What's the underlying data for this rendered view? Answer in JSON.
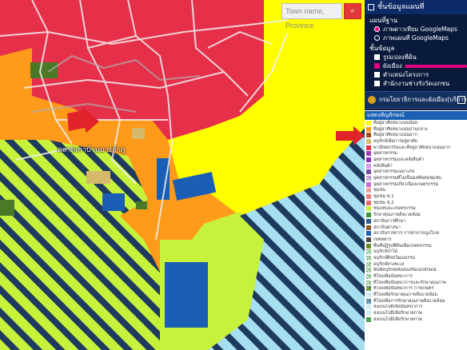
{
  "map": {
    "place_label": "ตลาดเก่าบ้านบางลำภู",
    "search_placeholder": "Town name, Province",
    "search_button_icon": "search-icon"
  },
  "panel": {
    "header_title": "ชั้นข้อมูลแผนที่",
    "basemap_title": "แผนที่ฐาน",
    "basemap_options": [
      {
        "label": "ภาพดาวเทียม GoogleMaps",
        "selected": true
      },
      {
        "label": "ภาพแผนที่ GoogleMaps",
        "selected": false
      }
    ],
    "layers_title": "ชั้นข้อมูล",
    "layers": [
      {
        "label": "รูปแปลงที่ดิน",
        "checked": false
      },
      {
        "label": "ผังเมือง",
        "checked": true
      },
      {
        "label": "ตำแหน่งโครงการ",
        "checked": false
      },
      {
        "label": "สำนักงานช่างรังวัดเอกชน",
        "checked": false
      }
    ],
    "department": "กรมโยธาธิการและผังเมือง(บริการข้อมูล)"
  },
  "legend": {
    "title": "แสดงสัญลักษณ์",
    "items": [
      {
        "label": "ที่อยู่อาศัยหนาแน่นน้อย",
        "color": "#ffff00",
        "hatch": ""
      },
      {
        "label": "ที่อยู่อาศัยหนาแน่นปานกลาง",
        "color": "#ff9a1a",
        "hatch": ""
      },
      {
        "label": "ที่อยู่อาศัยหนาแน่นมาก",
        "color": "#a34b1f",
        "hatch": ""
      },
      {
        "label": "อนุรักษ์เพื่อการอยู่อาศัย",
        "color": "#d6b96a",
        "hatch": ""
      },
      {
        "label": "พาณิชยกรรมและที่อยู่อาศัยหนาแน่นมาก",
        "color": "#e6304a",
        "hatch": ""
      },
      {
        "label": "อุตสาหกรรม",
        "color": "#a03ec4",
        "hatch": ""
      },
      {
        "label": "อุตสาหกรรมและคลังสินค้า",
        "color": "#8a2fb8",
        "hatch": ""
      },
      {
        "label": "คลังสินค้า",
        "color": "#d49be8",
        "hatch": ""
      },
      {
        "label": "อุตสาหกรรมเฉพาะกิจ",
        "color": "#7a4aa8",
        "hatch": ""
      },
      {
        "label": "อุตสาหกรรมที่ไม่เป็นมลพิษต่อชุมชน",
        "color": "#b46ad0",
        "hatch": "h3"
      },
      {
        "label": "อุตสาหกรรมเกี่ยวเนื่องเกษตรกรรม",
        "color": "#c56bd4",
        "hatch": ""
      },
      {
        "label": "ชุมชน",
        "color": "#f0a0a0",
        "hatch": ""
      },
      {
        "label": "ชุมชน ช.1",
        "color": "#f08080",
        "hatch": ""
      },
      {
        "label": "ชุมชน ช.2",
        "color": "#e86a6a",
        "hatch": ""
      },
      {
        "label": "ชนบทและเกษตรกรรม",
        "color": "#c7f23c",
        "hatch": ""
      },
      {
        "label": "รักษาคุณภาพสิ่งแวดล้อม",
        "color": "#3f8f3f",
        "hatch": ""
      },
      {
        "label": "สถาบันการศึกษา",
        "color": "#2a5f8a",
        "hatch": ""
      },
      {
        "label": "สถาบันศาสนา",
        "color": "#8a5a2a",
        "hatch": ""
      },
      {
        "label": "สถาบันราชการ การสาธารณูปโภค",
        "color": "#1a5fb4",
        "hatch": ""
      },
      {
        "label": "เขตทหาร",
        "color": "#4a4a4a",
        "hatch": ""
      },
      {
        "label": "พื้นที่ปฏิรูปที่ดินเพื่อเกษตรกรรม",
        "color": "#6a8a2a",
        "hatch": ""
      },
      {
        "label": "อนุรักษ์ป่าไม้",
        "color": "#4a9d4a",
        "hatch": "h1"
      },
      {
        "label": "อนุรักษ์ศิลปวัฒนธรรม",
        "color": "#7ac97a",
        "hatch": "h1"
      },
      {
        "label": "อนุรักษ์ทางทะเล",
        "color": "#8ecf8e",
        "hatch": "h1"
      },
      {
        "label": "พื้นที่อนุรักษ์เพื่อส่งเสริมเอกลักษณ์",
        "color": "#a6e0a6",
        "hatch": "h1"
      },
      {
        "label": "ที่โล่งเพื่อนันทนาการ",
        "color": "#b8e8b8",
        "hatch": "h1"
      },
      {
        "label": "ที่โล่งเพื่อนันทนาการและรักษาคุณภาพ",
        "color": "#cfeecf",
        "hatch": "h1"
      },
      {
        "label": "ที่โล่งเพื่อนันทนาการ การเกษตร",
        "color": "#c7f23c",
        "hatch": "h4"
      },
      {
        "label": "ที่โล่งเพื่อรักษาคุณภาพสิ่งแวดล้อม",
        "color": "#a6dff0",
        "hatch": "h2"
      },
      {
        "label": "ที่โล่งเพื่อการรักษาคุณภาพสิ่งแวดล้อม",
        "color": "#8fd0e8",
        "hatch": "h5"
      },
      {
        "label": "ลงเบนโปมีเพื่อนันทนาการ",
        "color": "#b0e0f0",
        "hatch": "h2"
      },
      {
        "label": "ลงเบนโปมีเพื่อรักษาสภาพ",
        "color": "#c0e8f5",
        "hatch": "h2"
      },
      {
        "label": "ลงเบนโปมีเพื่อรักษาสภาพ",
        "color": "#4a9d4a",
        "hatch": ""
      }
    ]
  },
  "colors": {
    "commercial": "#e6304a",
    "residential_medium": "#ff9a1a",
    "residential_low": "#ffff00",
    "rural_agri": "#c7f23c",
    "government": "#1a5fb4",
    "environment_green": "#4a7a28",
    "open_space_hatch": "#a6dff0",
    "hatch_line": "#1e3a5f",
    "panel_bg": "#0a1a3c",
    "accent": "#e6007e",
    "arrow": "#e0242a"
  }
}
